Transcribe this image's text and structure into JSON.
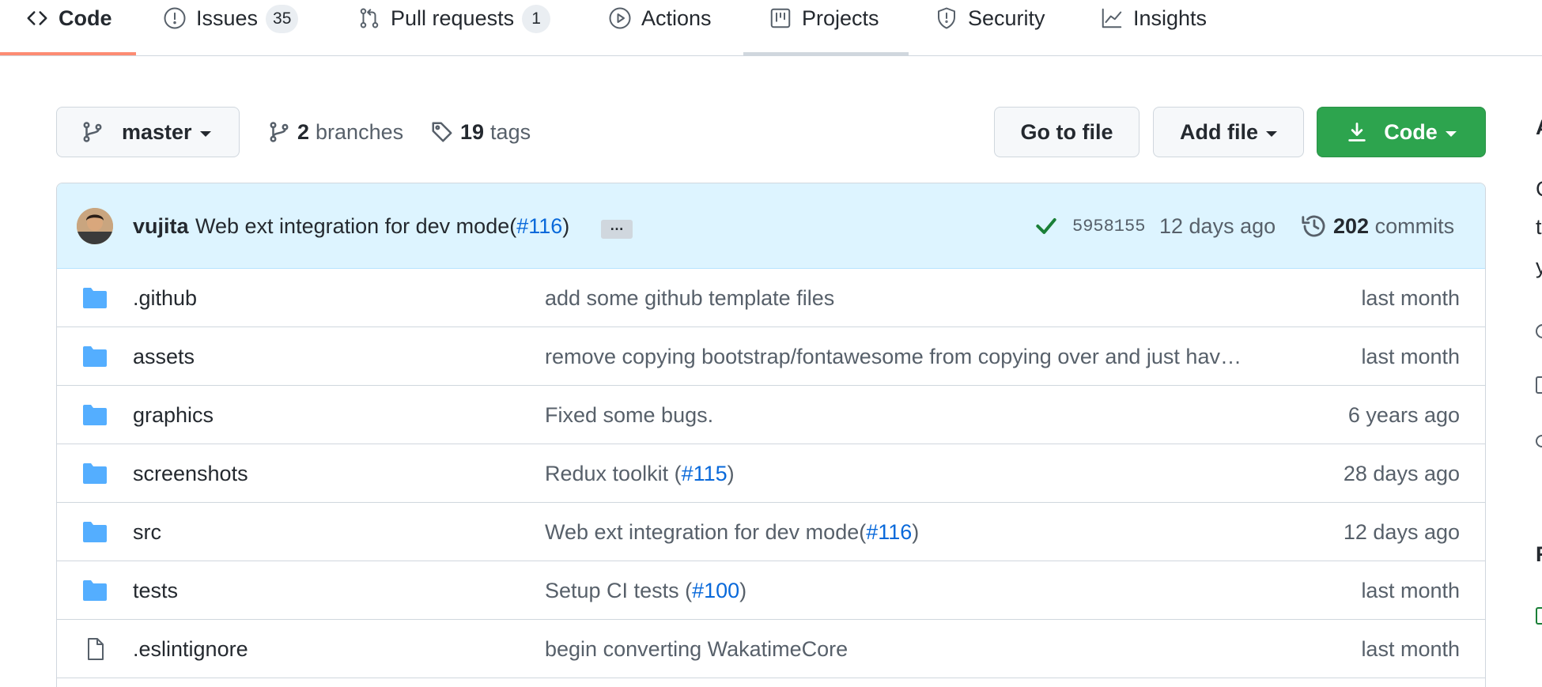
{
  "tabs": [
    {
      "label": "Code",
      "icon": "code-icon",
      "count": null,
      "selected": true
    },
    {
      "label": "Issues",
      "icon": "issue-opened-icon",
      "count": "35",
      "selected": false
    },
    {
      "label": "Pull requests",
      "icon": "git-pull-request-icon",
      "count": "1",
      "selected": false
    },
    {
      "label": "Actions",
      "icon": "play-icon",
      "count": null,
      "selected": false
    },
    {
      "label": "Projects",
      "icon": "project-icon",
      "count": null,
      "selected": false
    },
    {
      "label": "Security",
      "icon": "shield-icon",
      "count": null,
      "selected": false
    },
    {
      "label": "Insights",
      "icon": "graph-icon",
      "count": null,
      "selected": false
    }
  ],
  "branch": {
    "name": "master",
    "branches_count": "2",
    "branches_label": "branches",
    "tags_count": "19",
    "tags_label": "tags"
  },
  "actions": {
    "go_to_file": "Go to file",
    "add_file": "Add file",
    "code": "Code"
  },
  "latest_commit": {
    "author": "vujita",
    "message": "Web ext integration for dev mode(",
    "message_link": "#116",
    "message_suffix": ")",
    "ellipsis": "…",
    "status": "success",
    "sha": "5958155",
    "age": "12 days ago",
    "commits_count": "202",
    "commits_label": "commits"
  },
  "files": [
    {
      "type": "dir",
      "name": ".github",
      "message": "add some github template files",
      "link": "",
      "suffix": "",
      "age": "last month"
    },
    {
      "type": "dir",
      "name": "assets",
      "message": "remove copying bootstrap/fontawesome from copying over and just hav…",
      "link": "",
      "suffix": "",
      "age": "last month"
    },
    {
      "type": "dir",
      "name": "graphics",
      "message": "Fixed some bugs.",
      "link": "",
      "suffix": "",
      "age": "6 years ago"
    },
    {
      "type": "dir",
      "name": "screenshots",
      "message": "Redux toolkit (",
      "link": "#115",
      "suffix": ")",
      "age": "28 days ago"
    },
    {
      "type": "dir",
      "name": "src",
      "message": "Web ext integration for dev mode(",
      "link": "#116",
      "suffix": ")",
      "age": "12 days ago"
    },
    {
      "type": "dir",
      "name": "tests",
      "message": "Setup CI tests (",
      "link": "#100",
      "suffix": ")",
      "age": "last month"
    },
    {
      "type": "file",
      "name": ".eslintignore",
      "message": "begin converting WakatimeCore",
      "link": "",
      "suffix": "",
      "age": "last month"
    }
  ],
  "sidebar_partial": {
    "heading_char": "A",
    "line1_char": "C",
    "line2_char": "t",
    "line3_char": "y",
    "section2_char": "R"
  },
  "colors": {
    "accent_underline": "#fd8c73",
    "primary_button": "#2da44e",
    "link": "#0969da",
    "folder": "#54aeff",
    "commit_header_bg": "#ddf4ff"
  }
}
